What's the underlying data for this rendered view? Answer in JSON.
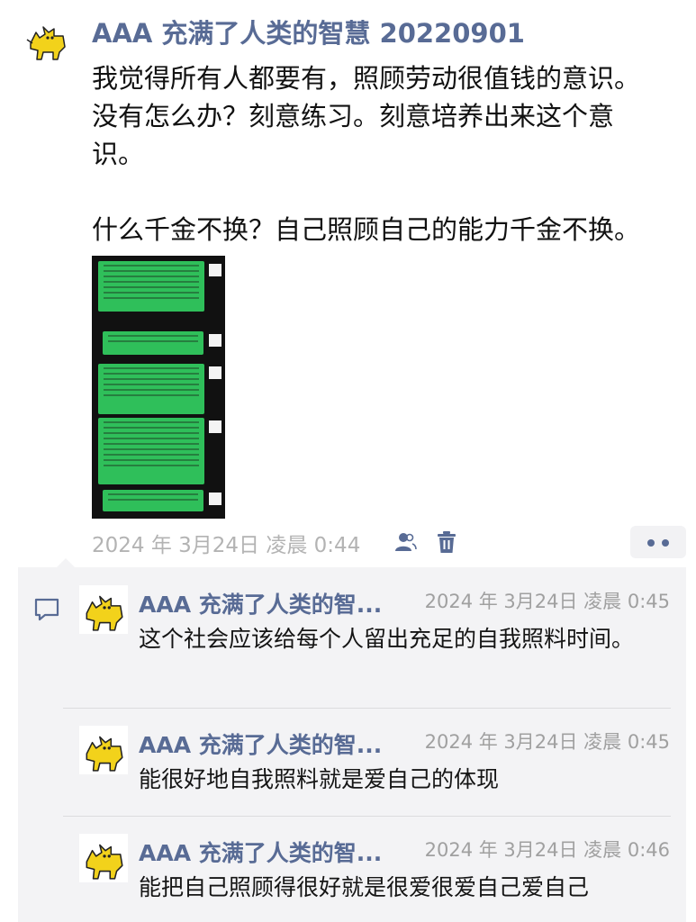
{
  "post": {
    "author": "AAA 充满了人类的智慧 20220901",
    "body": "我觉得所有人都要有，照顾劳动很值钱的意识。\n没有怎么办？刻意练习。刻意培养出来这个意\n识。\n\n什么千金不换？自己照顾自己的能力千金不换。",
    "timestamp": "2024 年 3月24日 凌晨 0:44",
    "visibility_icon": "people-icon",
    "delete_icon": "trash-icon",
    "more_icon": "more-dots-icon"
  },
  "comments": [
    {
      "author": "AAA 充满了人类的智...",
      "time": "2024 年 3月24日 凌晨 0:45",
      "text": "这个社会应该给每个人留出充足的自我照料时间。"
    },
    {
      "author": "AAA 充满了人类的智...",
      "time": "2024 年 3月24日 凌晨 0:45",
      "text": "能很好地自我照料就是爱自己的体现"
    },
    {
      "author": "AAA 充满了人类的智...",
      "time": "2024 年 3月24日 凌晨 0:46",
      "text": "能把自己照顾得很好就是很爱很爱自己爱自己"
    }
  ],
  "colors": {
    "name_blue": "#586b95",
    "bubble_green": "#2fbf5a",
    "panel_bg": "#f3f3f5",
    "meta_gray": "#b3b3b3"
  }
}
